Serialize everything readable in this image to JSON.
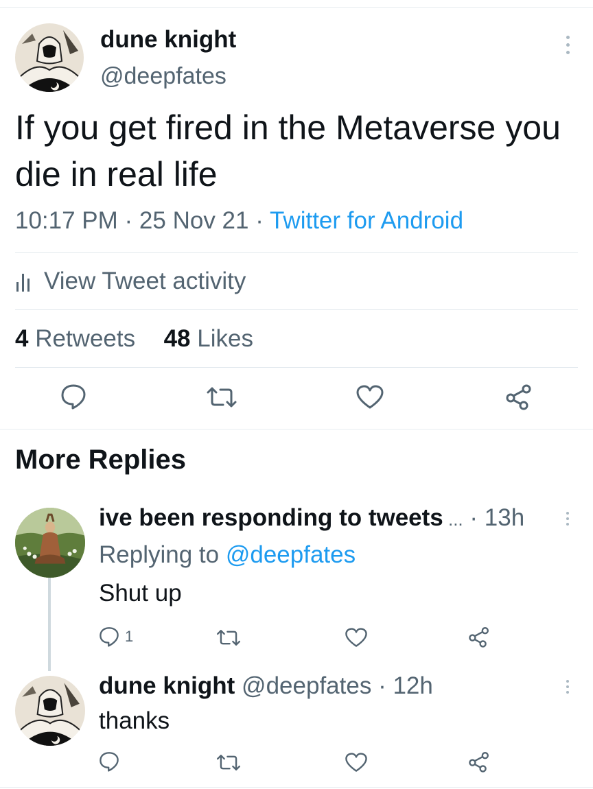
{
  "tweet": {
    "author_name": "dune knight",
    "author_handle": "@deepfates",
    "text": "If you get fired in the Metaverse you die in real life",
    "time": "10:17 PM",
    "date": "25 Nov 21",
    "source": "Twitter for Android",
    "separator": " · ",
    "view_activity_label": "View Tweet activity",
    "retweets_count": "4",
    "retweets_label": "Retweets",
    "likes_count": "48",
    "likes_label": "Likes"
  },
  "section": {
    "more_replies_label": "More Replies"
  },
  "replies": [
    {
      "author_name": "ive been responding to tweets",
      "truncation": " ...",
      "time": "· 13h",
      "replying_to_label": "Replying to",
      "replying_to_handle": "@deepfates",
      "text": "Shut up",
      "reply_count": "1"
    },
    {
      "author_name": "dune knight",
      "author_handle": "@deepfates",
      "time": "· 12h",
      "text": "thanks"
    }
  ],
  "icons": [
    "reply-icon",
    "retweet-icon",
    "like-icon",
    "share-icon",
    "more-icon",
    "tweet-activity-icon"
  ],
  "colors": {
    "link": "#1d9bf0",
    "secondary_text": "#536471",
    "primary_text": "#0f1419"
  }
}
